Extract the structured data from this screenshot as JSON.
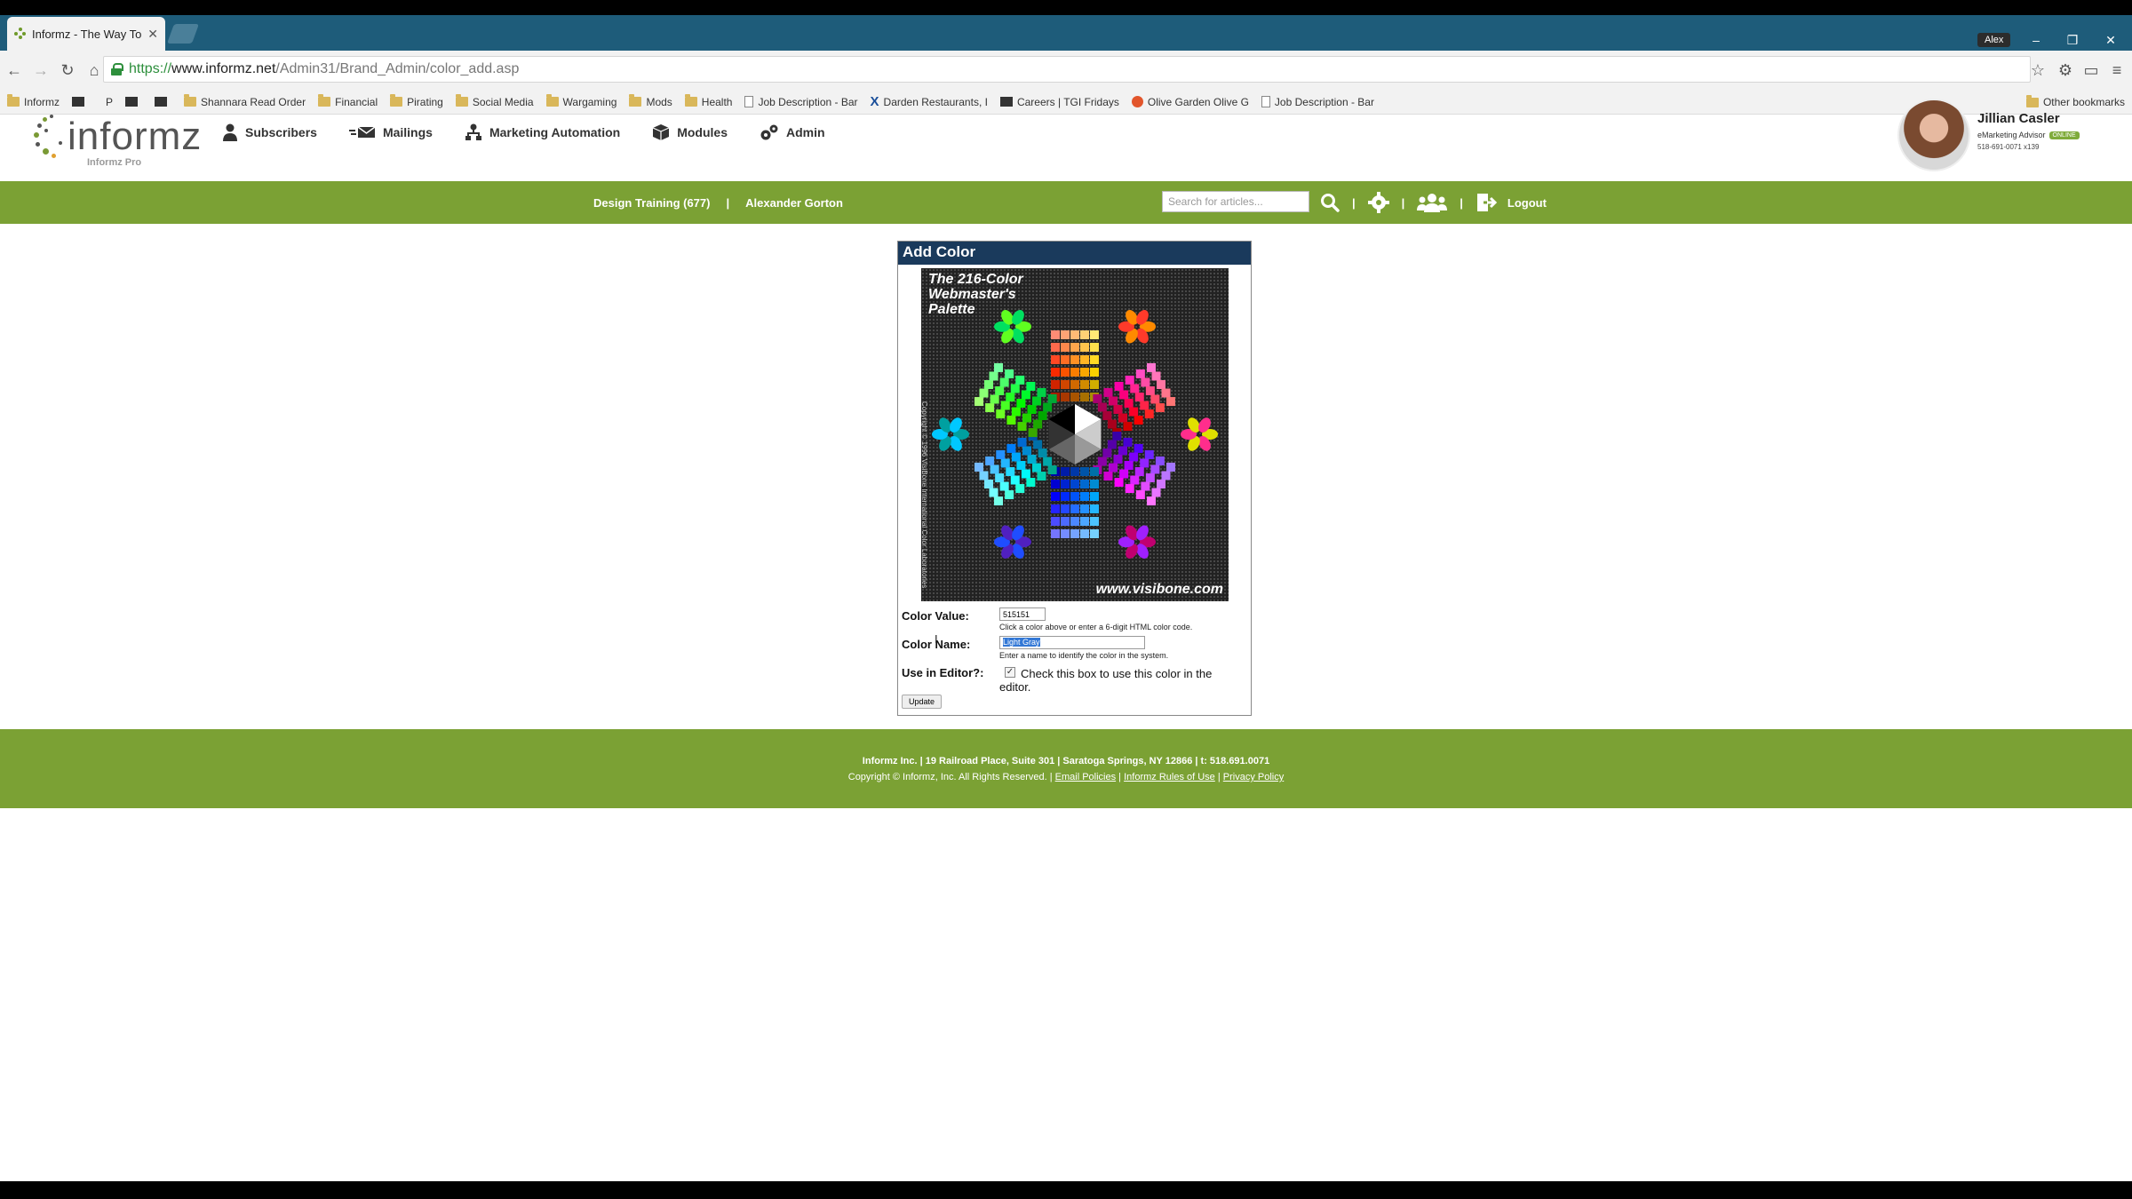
{
  "browser": {
    "tab_title": "Informz - The Way To Knc",
    "profile_name": "Alex",
    "url_scheme": "https://",
    "url_host": "www.informz.net",
    "url_path": "/Admin31/Brand_Admin/color_add.asp",
    "bookmarks": [
      {
        "label": "Informz",
        "icon": "folder-icon"
      },
      {
        "label": "",
        "icon": "block-icon"
      },
      {
        "label": "P",
        "icon": "p-icon"
      },
      {
        "label": "",
        "icon": "block-icon"
      },
      {
        "label": "",
        "icon": "block-icon"
      },
      {
        "label": "Shannara Read Order",
        "icon": "folder-icon"
      },
      {
        "label": "Financial",
        "icon": "folder-icon"
      },
      {
        "label": "Pirating",
        "icon": "folder-icon"
      },
      {
        "label": "Social Media",
        "icon": "folder-icon"
      },
      {
        "label": "Wargaming",
        "icon": "folder-icon"
      },
      {
        "label": "Mods",
        "icon": "folder-icon"
      },
      {
        "label": "Health",
        "icon": "folder-icon"
      },
      {
        "label": "Job Description - Bar",
        "icon": "page-icon"
      },
      {
        "label": "Darden Restaurants, I",
        "icon": "x-icon"
      },
      {
        "label": "Careers | TGI Fridays",
        "icon": "block-icon"
      },
      {
        "label": "Olive Garden Olive G",
        "icon": "circle-icon"
      },
      {
        "label": "Job Description - Bar",
        "icon": "page-icon"
      }
    ],
    "other_bookmarks": "Other bookmarks"
  },
  "app": {
    "logo_text": "informz",
    "logo_sub": "Informz Pro",
    "nav": [
      {
        "label": "Subscribers"
      },
      {
        "label": "Mailings"
      },
      {
        "label": "Marketing Automation"
      },
      {
        "label": "Modules"
      },
      {
        "label": "Admin"
      }
    ],
    "user": {
      "name": "Jillian Casler",
      "role": "eMarketing Advisor",
      "status": "ONLINE",
      "phone": "518-691-0071 x139"
    },
    "account": "Design Training (677)",
    "account_user": "Alexander Gorton",
    "search_placeholder": "Search for articles...",
    "logout": "Logout"
  },
  "panel": {
    "title": "Add Color",
    "palette_title": "The 216-Color Webmaster's Palette",
    "palette_url": "www.visibone.com",
    "palette_copyright": "Copyright © 1996 VisiBone International Color Laboratories",
    "color_value_label": "Color Value:",
    "color_value": "515151",
    "color_value_help": "Click a color above or enter a 6-digit HTML color code.",
    "color_name_label": "Color Name:",
    "color_name": "Light Gray",
    "color_name_help": "Enter a name to identify the color in the system.",
    "editor_label": "Use in Editor?:",
    "editor_checked": true,
    "editor_text": "Check this box to use this color in the editor.",
    "update_button": "Update"
  },
  "footer": {
    "line1": "Informz Inc. | 19 Railroad Place, Suite 301 | Saratoga Springs, NY 12866 | t: 518.691.0071",
    "copyright": "Copyright © Informz, Inc. All Rights Reserved. |",
    "link1": "Email Policies",
    "link2": "Informz Rules of Use",
    "link3": "Privacy Policy"
  },
  "colors": {
    "brand_green": "#7ba134",
    "panel_header": "#1a3a5c",
    "chrome_tabstrip": "#1e5c7a"
  }
}
